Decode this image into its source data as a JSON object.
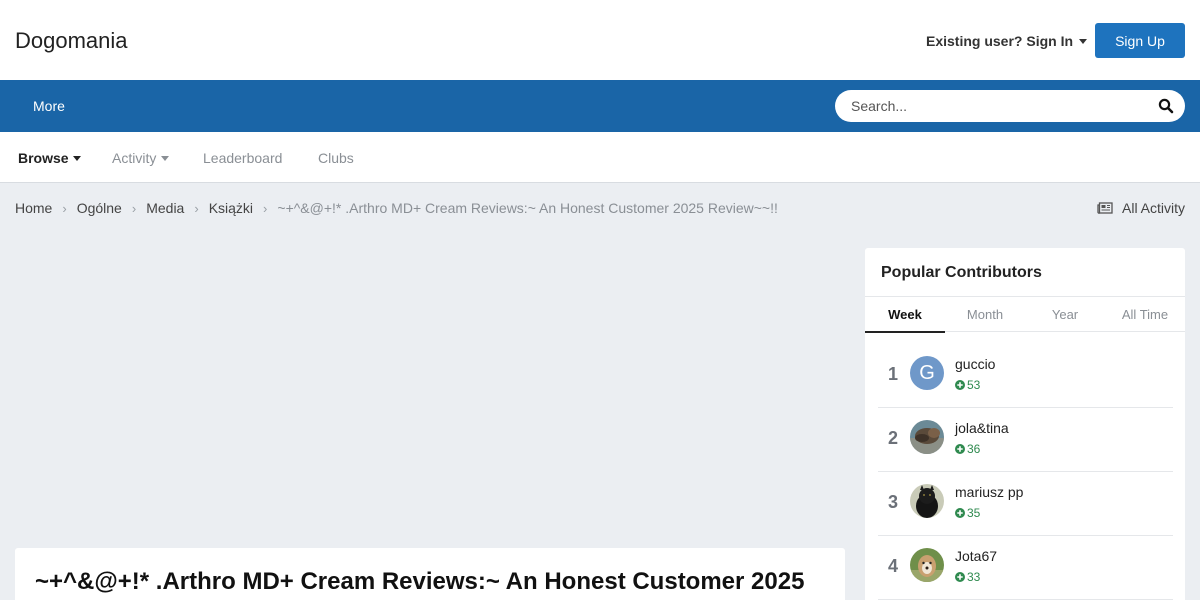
{
  "header": {
    "logo": "Dogomania",
    "signin_label": "Existing user? Sign In",
    "signup_label": "Sign Up"
  },
  "navbar": {
    "more_label": "More",
    "search_placeholder": "Search..."
  },
  "subnav": {
    "items": [
      {
        "label": "Browse"
      },
      {
        "label": "Activity"
      },
      {
        "label": "Leaderboard"
      },
      {
        "label": "Clubs"
      }
    ]
  },
  "breadcrumb": {
    "items": [
      "Home",
      "Ogólne",
      "Media",
      "Książki"
    ],
    "current": "~+^&@+!* .Arthro MD+ Cream Reviews:~ An Honest Customer 2025 Review~~!!"
  },
  "all_activity_label": "All Activity",
  "post": {
    "title": "~+^&@+!* .Arthro MD+ Cream Reviews:~ An Honest Customer 2025"
  },
  "widget": {
    "title": "Popular Contributors",
    "tabs": [
      "Week",
      "Month",
      "Year",
      "All Time"
    ],
    "contributors": [
      {
        "rank": "1",
        "name": "guccio",
        "points": "53",
        "avatar_letter": "G"
      },
      {
        "rank": "2",
        "name": "jola&tina",
        "points": "36"
      },
      {
        "rank": "3",
        "name": "mariusz pp",
        "points": "35"
      },
      {
        "rank": "4",
        "name": "Jota67",
        "points": "33"
      }
    ]
  },
  "colors": {
    "brand": "#1a65a7",
    "button": "#1e73be",
    "reputation": "#2f8a4f"
  }
}
